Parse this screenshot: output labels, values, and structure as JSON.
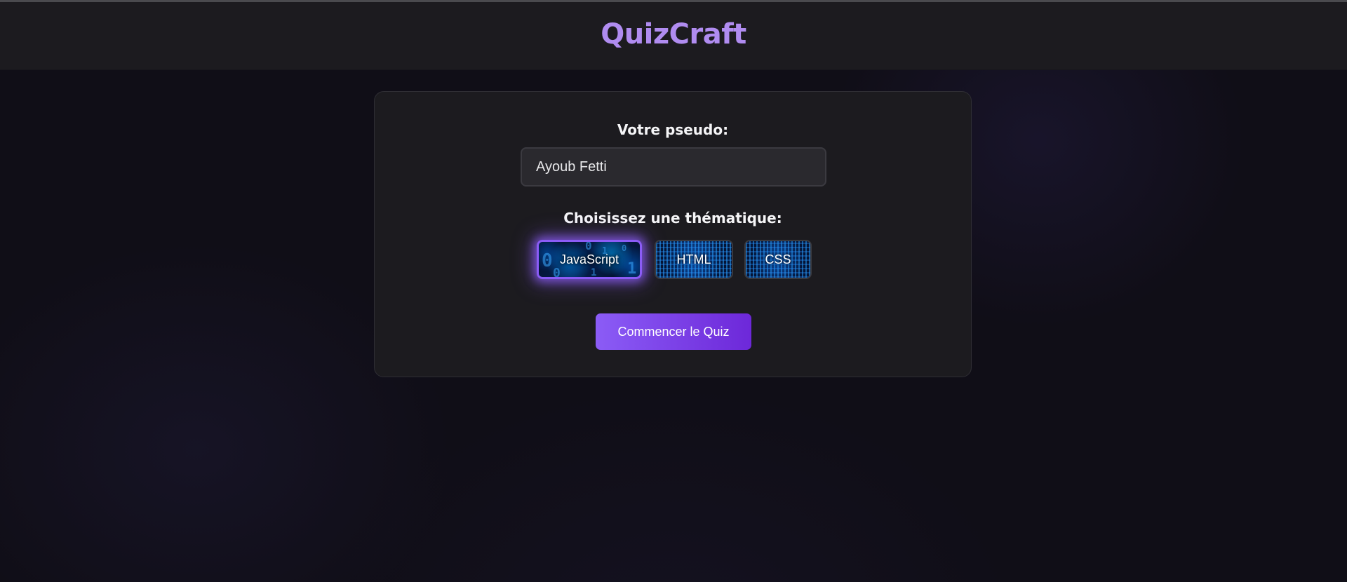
{
  "app": {
    "title": "QuizCraft"
  },
  "form": {
    "pseudo_label": "Votre pseudo:",
    "pseudo_value": "Ayoub Fetti",
    "theme_label": "Choisissez une thématique:",
    "themes": [
      {
        "label": "JavaScript",
        "selected": true
      },
      {
        "label": "HTML",
        "selected": false
      },
      {
        "label": "CSS",
        "selected": false
      }
    ],
    "start_label": "Commencer le Quiz"
  },
  "colors": {
    "accent": "#8b5cf6",
    "accent_dark": "#6d28d9",
    "logo": "#b08cf0",
    "card_background": "#1c1b1f",
    "page_background": "#100e17"
  }
}
